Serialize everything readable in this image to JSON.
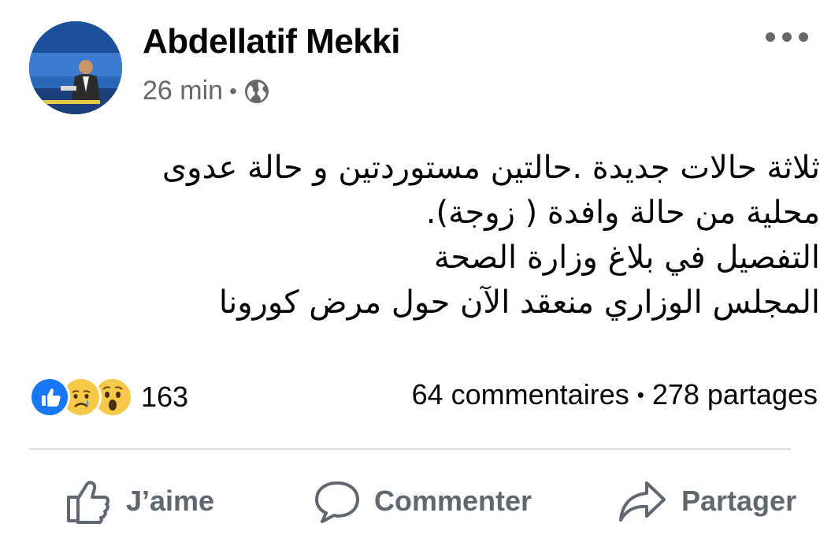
{
  "post": {
    "author": "Abdellatif Mekki",
    "time": "26 min",
    "separator": "•",
    "privacy_icon": "globe-icon",
    "more_icon": "more-horizontal-icon",
    "lines": [
      "ثلاثة حالات جديدة .حالتين مستوردتين و حالة عدوى",
      "محلية من حالة وافدة ( زوجة).",
      "التفصيل في بلاغ وزارة الصحة",
      "المجلس الوزاري منعقد الآن حول مرض كورونا"
    ]
  },
  "engagement": {
    "reaction_icons": [
      "like-icon",
      "sad-icon",
      "wow-icon"
    ],
    "reaction_count": "163",
    "comments": "64 commentaires",
    "dot": "•",
    "shares": "278 partages"
  },
  "actions": {
    "like_label": "J’aime",
    "comment_label": "Commenter",
    "share_label": "Partager"
  },
  "colors": {
    "secondary_text": "#65676b",
    "action_text": "#606770",
    "like_blue": "#1877f2",
    "divider": "#dadde1"
  }
}
